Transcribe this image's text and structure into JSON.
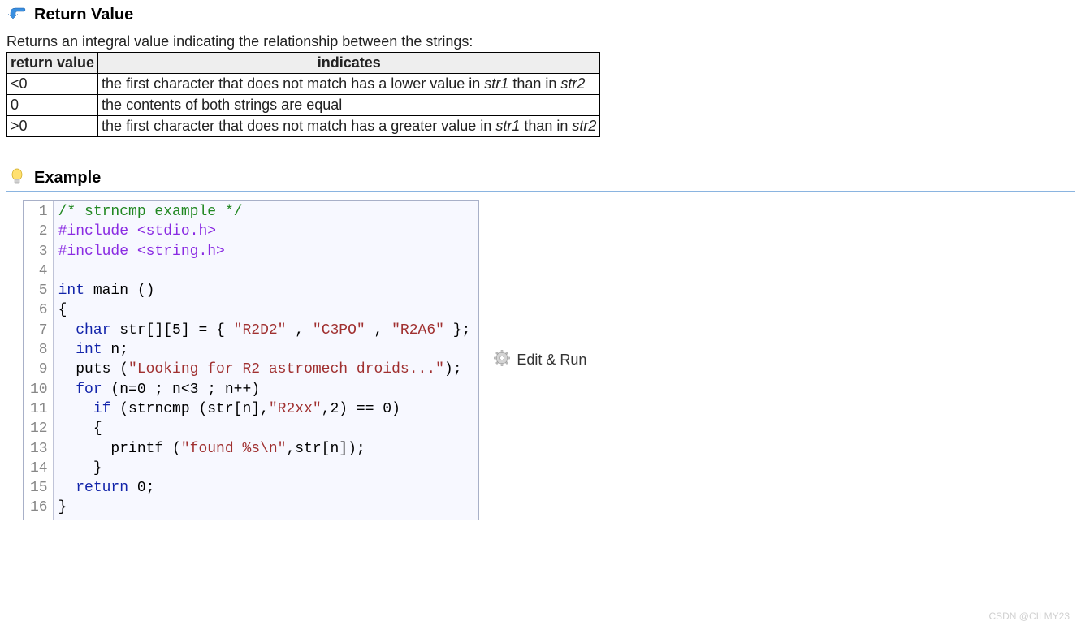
{
  "return_value": {
    "title": "Return Value",
    "description": "Returns an integral value indicating the relationship between the strings:",
    "table": {
      "headers": [
        "return value",
        "indicates"
      ],
      "rows": [
        {
          "value": "<0",
          "desc_pre": "the first character that does not match has a lower value in ",
          "str1": "str1",
          "desc_mid": " than in ",
          "str2": "str2"
        },
        {
          "value": "0",
          "desc_full": "the contents of both strings are equal"
        },
        {
          "value": ">0",
          "desc_pre": "the first character that does not match has a greater value in ",
          "str1": "str1",
          "desc_mid": " than in ",
          "str2": "str2"
        }
      ]
    }
  },
  "example": {
    "title": "Example",
    "edit_run_label": "Edit & Run",
    "total_lines": 16,
    "code_lines": [
      {
        "n": 1,
        "type": "comment",
        "text": "/* strncmp example */"
      },
      {
        "n": 2,
        "type": "preproc",
        "text": "#include <stdio.h>"
      },
      {
        "n": 3,
        "type": "preproc",
        "text": "#include <string.h>"
      },
      {
        "n": 4,
        "type": "blank",
        "text": ""
      },
      {
        "n": 5,
        "type": "mixed",
        "kw": "int",
        "rest": " main ()"
      },
      {
        "n": 6,
        "type": "plain",
        "text": "{"
      },
      {
        "n": 7,
        "type": "char_decl",
        "indent": "  ",
        "kw": "char",
        "mid1": " str[][5] = { ",
        "s1": "\"R2D2\"",
        "sep1": " , ",
        "s2": "\"C3PO\"",
        "sep2": " , ",
        "s3": "\"R2A6\"",
        "tail": " };"
      },
      {
        "n": 8,
        "type": "mixed",
        "indent": "  ",
        "kw": "int",
        "rest": " n;"
      },
      {
        "n": 9,
        "type": "call_str",
        "indent": "  ",
        "pre": "puts (",
        "s": "\"Looking for R2 astromech droids...\"",
        "post": ");"
      },
      {
        "n": 10,
        "type": "for",
        "indent": "  ",
        "kw": "for",
        "rest": " (n=0 ; n<3 ; n++)"
      },
      {
        "n": 11,
        "type": "if_str",
        "indent": "    ",
        "kw": "if",
        "pre": " (strncmp (str[n],",
        "s": "\"R2xx\"",
        "post": ",2) == 0)"
      },
      {
        "n": 12,
        "type": "plain",
        "text": "    {"
      },
      {
        "n": 13,
        "type": "printf",
        "indent": "      ",
        "pre": "printf (",
        "s": "\"found %s\\n\"",
        "post": ",str[n]);"
      },
      {
        "n": 14,
        "type": "plain",
        "text": "    }"
      },
      {
        "n": 15,
        "type": "return",
        "indent": "  ",
        "kw": "return",
        "rest": " 0;"
      },
      {
        "n": 16,
        "type": "plain",
        "text": "}"
      }
    ]
  },
  "watermark": "CSDN @CILMY23"
}
